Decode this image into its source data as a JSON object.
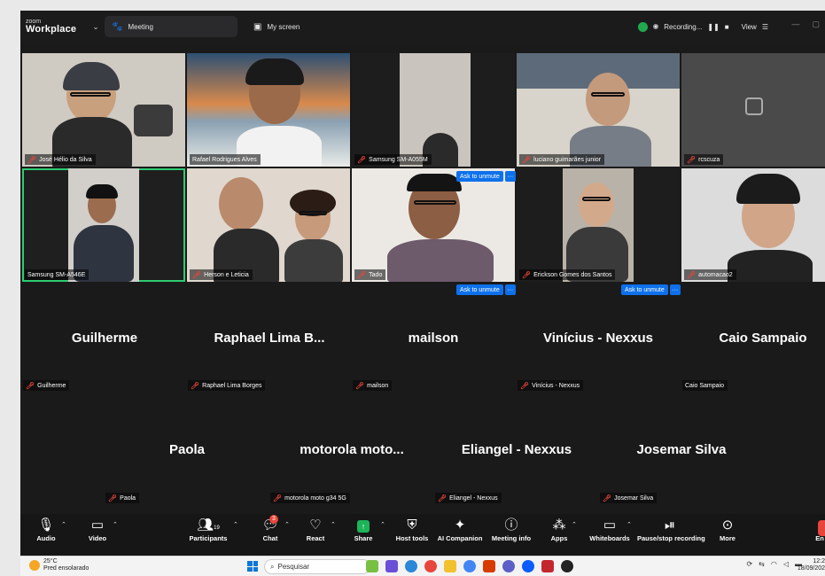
{
  "app": {
    "brand_small": "zoom",
    "brand_big": "Workplace"
  },
  "tabs": [
    {
      "label": "Meeting"
    },
    {
      "label": "My screen"
    }
  ],
  "status": {
    "recording": "Recording...",
    "view": "View"
  },
  "video_tiles": [
    {
      "name": "José Hélio da Silva",
      "muted": true
    },
    {
      "name": "Rafael Rodrigues Alves",
      "muted": false
    },
    {
      "name": "Samsung SM-A055M",
      "muted": true
    },
    {
      "name": "luciano guimarães junior",
      "muted": true
    },
    {
      "name": "rcscuza",
      "muted": true
    },
    {
      "name": "Samsung SM-A546E",
      "muted": false
    },
    {
      "name": "Herson e Leticia",
      "muted": true
    },
    {
      "name": "Tado",
      "muted": true
    },
    {
      "name": "Erickson Gomes dos Santos",
      "muted": true
    },
    {
      "name": "automacao2",
      "muted": true
    }
  ],
  "ask_to_unmute": "Ask to unmute",
  "ask_more": "···",
  "audio_tiles_row1": [
    {
      "display": "Guilherme",
      "tag": "Guilherme",
      "muted": true
    },
    {
      "display": "Raphael Lima B...",
      "tag": "Raphael Lima Borges",
      "muted": true
    },
    {
      "display": "mailson",
      "tag": "mailson",
      "muted": true
    },
    {
      "display": "Vinícius - Nexxus",
      "tag": "Vinícius - Nexxus",
      "muted": true
    },
    {
      "display": "Caio Sampaio",
      "tag": "Caio Sampaio",
      "muted": false
    }
  ],
  "audio_tiles_row2": [
    {
      "display": "Paola",
      "tag": "Paola",
      "muted": true
    },
    {
      "display": "motorola moto...",
      "tag": "motorola moto g34 5G",
      "muted": true
    },
    {
      "display": "Eliangel - Nexxus",
      "tag": "Eliangel - Nexxus",
      "muted": true
    },
    {
      "display": "Josemar Silva",
      "tag": "Josemar Silva",
      "muted": true
    }
  ],
  "toolbar": {
    "audio": "Audio",
    "video": "Video",
    "participants": "Participants",
    "participants_count": "19",
    "chat": "Chat",
    "chat_badge": "3",
    "react": "React",
    "share": "Share",
    "host_tools": "Host tools",
    "ai": "AI Companion",
    "info": "Meeting info",
    "apps": "Apps",
    "whiteboards": "Whiteboards",
    "pause": "Pause/stop recording",
    "more": "More",
    "end": "En"
  },
  "taskbar": {
    "temp": "25°C",
    "weather": "Pred ensolarado",
    "search": "Pesquisar",
    "time": "12:2",
    "date": "18/09/202"
  },
  "colors": {
    "accent": "#0e71eb",
    "active_speaker": "#2ecc71",
    "muted": "#e8453c",
    "share": "#1db45a"
  }
}
